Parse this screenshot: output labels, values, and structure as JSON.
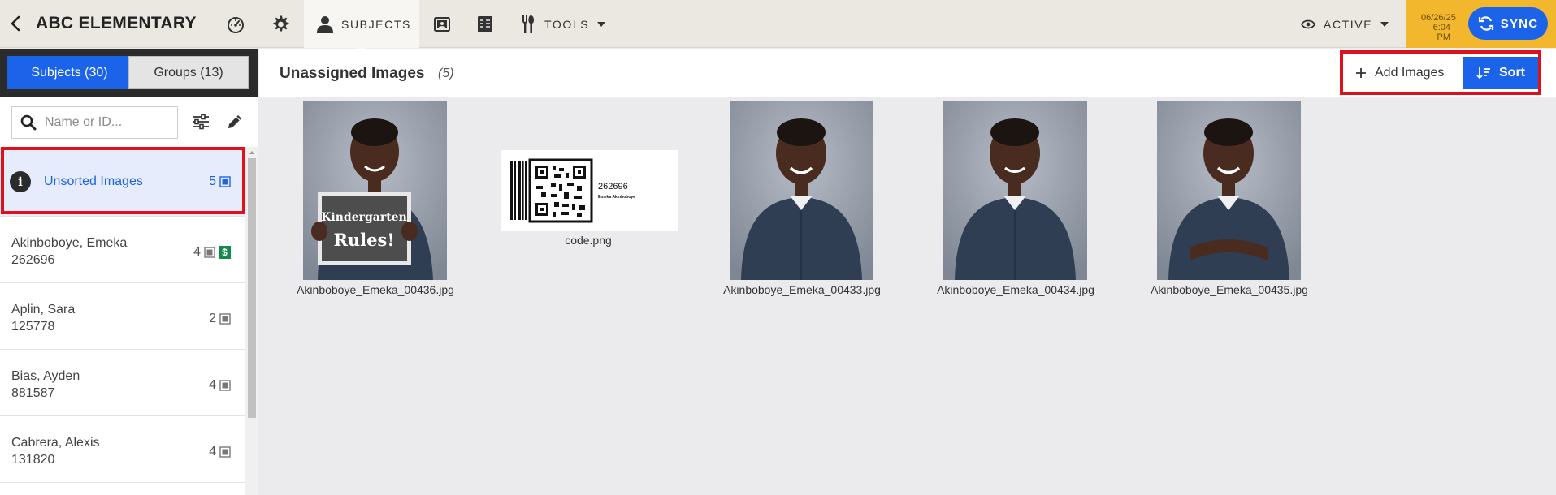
{
  "header": {
    "school_name": "ABC ELEMENTARY",
    "nav": {
      "subjects_label": "SUBJECTS",
      "tools_label": "TOOLS"
    },
    "active_label": "ACTIVE",
    "sync_date": "06/26/25",
    "sync_time": "6:04 PM",
    "sync_label": "SYNC"
  },
  "sidebar": {
    "tabs": {
      "subjects": "Subjects (30)",
      "groups": "Groups (13)"
    },
    "search_placeholder": "Name or ID...",
    "items": [
      {
        "title": "Unsorted Images",
        "sub": "",
        "count": "5",
        "selected": true
      },
      {
        "title": "Akinboboye, Emeka",
        "sub": "262696",
        "count": "4",
        "paid": "$"
      },
      {
        "title": "Aplin, Sara",
        "sub": "125778",
        "count": "2"
      },
      {
        "title": "Bias, Ayden",
        "sub": "881587",
        "count": "4"
      },
      {
        "title": "Cabrera, Alexis",
        "sub": "131820",
        "count": "4"
      }
    ]
  },
  "main": {
    "title": "Unassigned Images",
    "count": "(5)",
    "add_images_label": "Add Images",
    "sort_label": "Sort",
    "images": [
      {
        "caption": "Akinboboye_Emeka_00436.jpg",
        "sign_line1": "Kindergarten",
        "sign_line2": "Rules!"
      },
      {
        "caption": "code.png",
        "code_id": "262696",
        "code_name": "Emeka Akinboboye"
      },
      {
        "caption": "Akinboboye_Emeka_00433.jpg"
      },
      {
        "caption": "Akinboboye_Emeka_00434.jpg"
      },
      {
        "caption": "Akinboboye_Emeka_00435.jpg"
      }
    ]
  },
  "colors": {
    "accent": "#1b63e8",
    "sync_bg": "#f3b72e",
    "highlight": "#e0101a",
    "paid_green": "#138a4a"
  }
}
